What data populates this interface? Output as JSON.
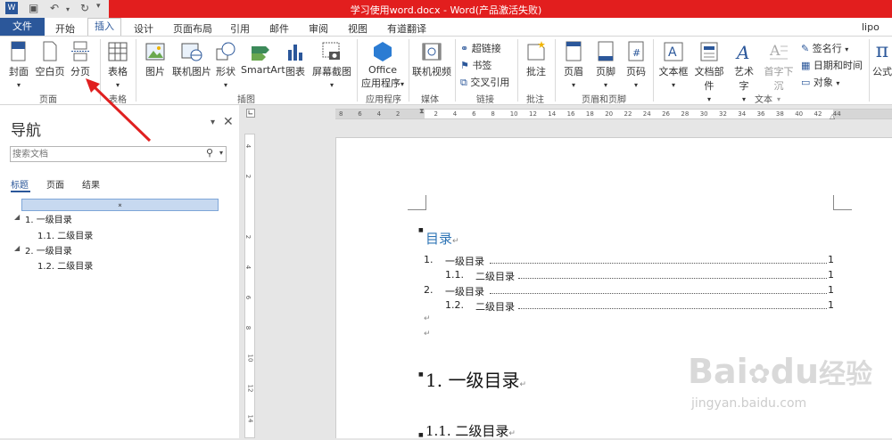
{
  "window": {
    "title": "学习使用word.docx - Word(产品激活失败)",
    "user": "lipo"
  },
  "tabs": [
    "文件",
    "开始",
    "插入",
    "设计",
    "页面布局",
    "引用",
    "邮件",
    "审阅",
    "视图",
    "有道翻译"
  ],
  "ribbon": {
    "groups": {
      "pages": "页面",
      "tables": "表格",
      "illustrations": "插图",
      "apps": "应用程序",
      "media": "媒体",
      "links": "链接",
      "comments": "批注",
      "header_footer": "页眉和页脚",
      "text": "文本"
    },
    "buttons": {
      "cover": "封面",
      "blank": "空白页",
      "page_break": "分页",
      "table": "表格",
      "picture": "图片",
      "online_picture": "联机图片",
      "shapes": "形状",
      "smartart": "SmartArt",
      "chart": "图表",
      "screenshot": "屏幕截图",
      "office_apps_1": "Office",
      "office_apps_2": "应用程序",
      "online_video": "联机视频",
      "hyperlink": "超链接",
      "bookmark": "书签",
      "crossref": "交叉引用",
      "comment": "批注",
      "header": "页眉",
      "footer": "页脚",
      "page_number": "页码",
      "textbox": "文本框",
      "quickparts": "文档部件",
      "wordart": "艺术字",
      "dropcap": "首字下沉",
      "signature": "签名行",
      "datetime": "日期和时间",
      "object": "对象",
      "equation": "公式"
    }
  },
  "nav": {
    "title": "导航",
    "search_placeholder": "搜索文档",
    "tabs": [
      "标题",
      "页面",
      "结果"
    ],
    "tree": [
      {
        "label": "1. 一级目录",
        "level": 1
      },
      {
        "label": "1.1. 二级目录",
        "level": 2
      },
      {
        "label": "2. 一级目录",
        "level": 1
      },
      {
        "label": "1.2. 二级目录",
        "level": 2
      }
    ]
  },
  "ruler": [
    "8",
    "6",
    "4",
    "2",
    "",
    "2",
    "4",
    "6",
    "8",
    "10",
    "12",
    "14",
    "16",
    "18",
    "20",
    "22",
    "24",
    "26",
    "28",
    "30",
    "32",
    "34",
    "36",
    "38",
    "40",
    "42",
    "44"
  ],
  "ruler_v": [
    "4",
    "2",
    "",
    "2",
    "4",
    "6",
    "8",
    "10",
    "12",
    "14"
  ],
  "doc": {
    "toc_heading": "目录",
    "toc": [
      {
        "num": "1.",
        "text": "一级目录",
        "page": "1"
      },
      {
        "num": "1.1.",
        "text": "二级目录",
        "page": "1"
      },
      {
        "num": "2.",
        "text": "一级目录",
        "page": "1"
      },
      {
        "num": "1.2.",
        "text": "二级目录",
        "page": "1"
      }
    ],
    "h1": "1. 一级目录",
    "h2": "1.1. 二级目录",
    "para_mark": "↵"
  },
  "watermark": {
    "text1": "Bai",
    "text2": "du",
    "text3": "经验",
    "url": "jingyan.baidu.com"
  },
  "colors": {
    "accent": "#2b579a",
    "titlebar": "#e21e1e",
    "arrow": "#e02020",
    "nav_highlight": "#c7d9f0"
  }
}
